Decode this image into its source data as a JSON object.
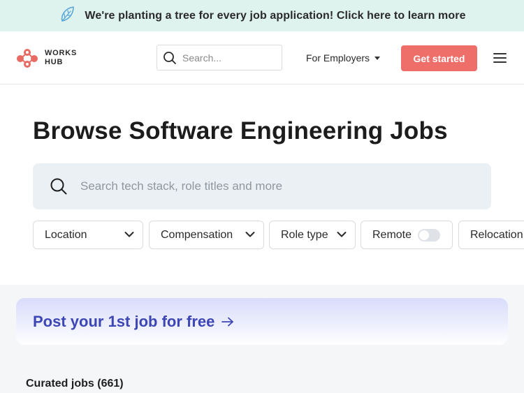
{
  "banner": {
    "text": "We're planting a tree for every job application! Click here to learn more",
    "icon": "leaf-icon"
  },
  "header": {
    "logo_line1": "WORKS",
    "logo_line2": "HUB",
    "search_placeholder": "Search...",
    "employers_label": "For Employers",
    "get_started_label": "Get started",
    "accent": "#ee6e6a"
  },
  "main": {
    "title": "Browse Software Engineering Jobs",
    "search_placeholder": "Search tech stack, role titles and more",
    "filters": {
      "location": "Location",
      "compensation": "Compensation",
      "role_type": "Role type",
      "remote": "Remote",
      "remote_on": false,
      "relocation": "Relocation"
    }
  },
  "promo": {
    "text": "Post your 1st job for free",
    "arrow": "→"
  },
  "jobs": {
    "curated_label": "Curated jobs (661)"
  }
}
